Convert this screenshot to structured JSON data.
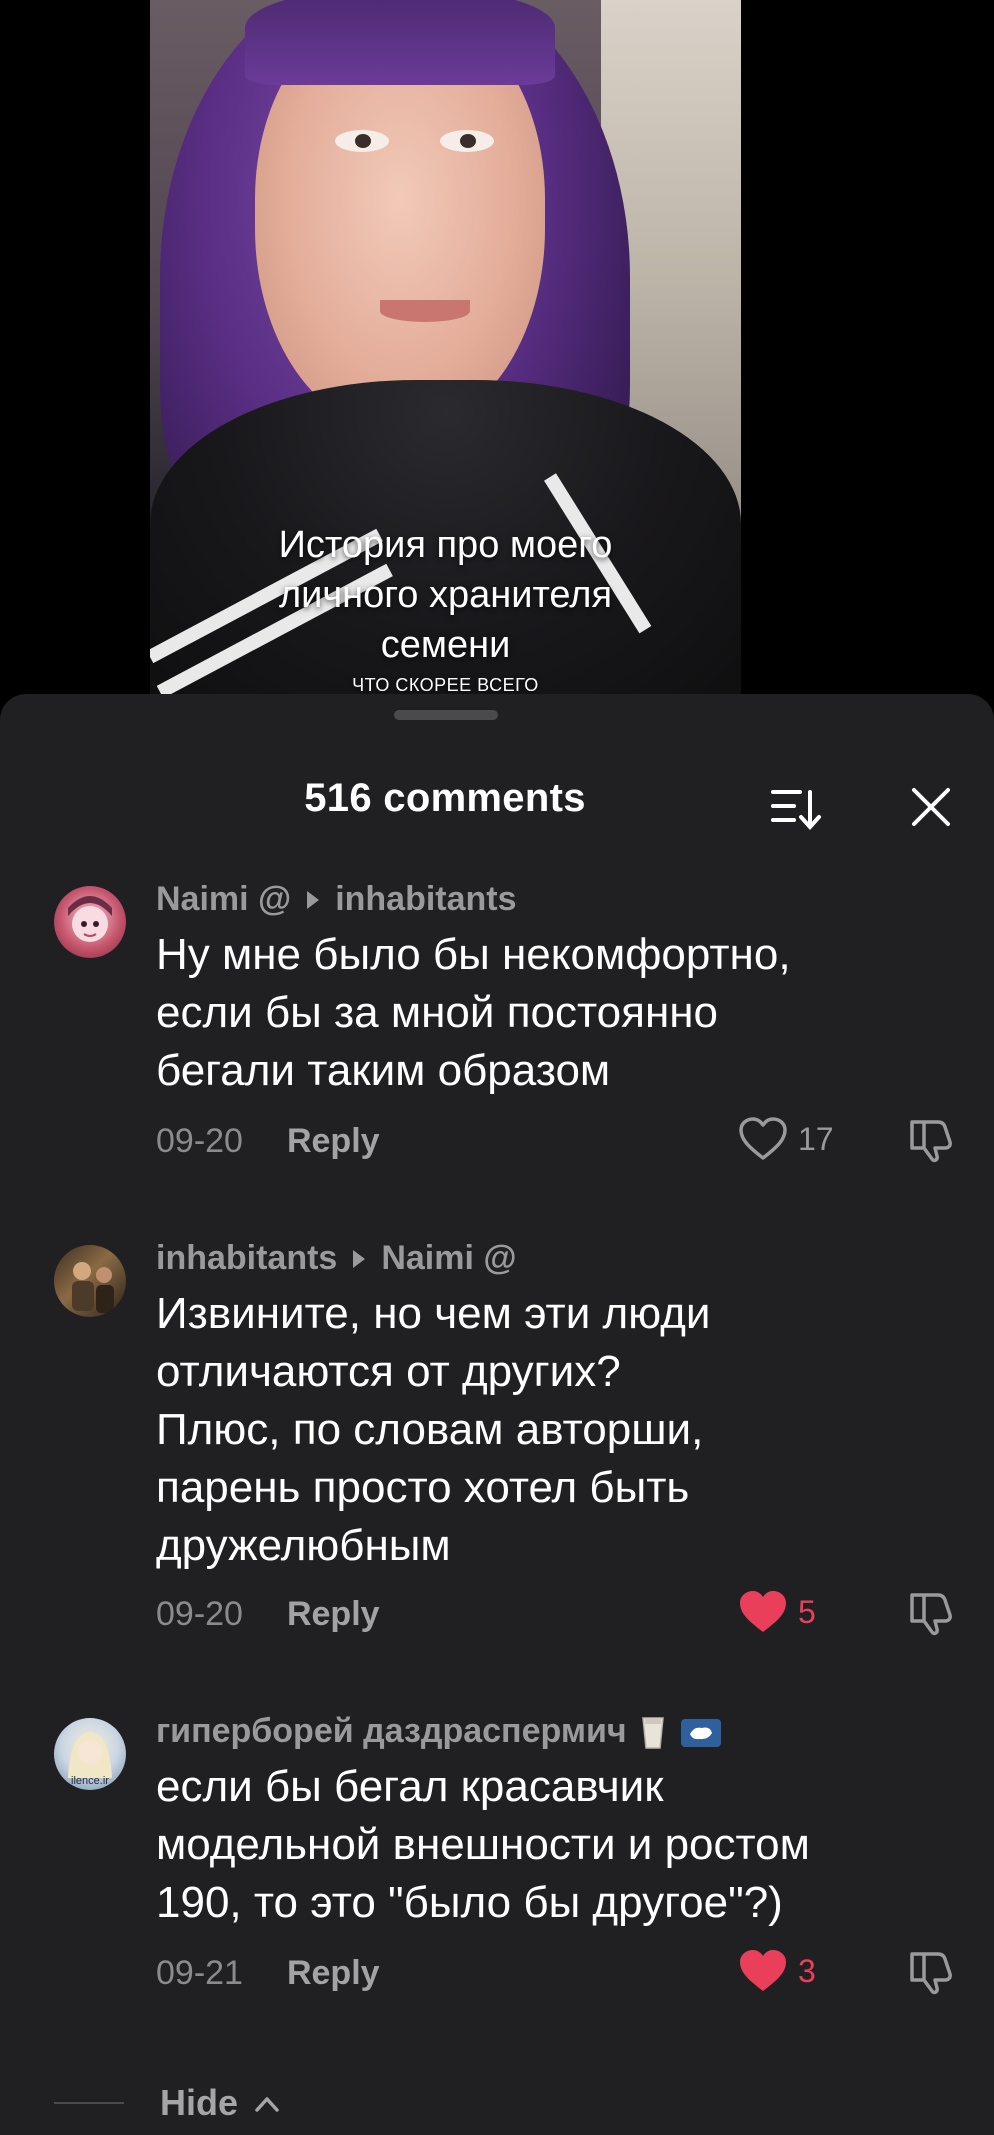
{
  "video": {
    "caption_line1": "История про моего",
    "caption_line2": "личного хранителя",
    "caption_line3": "семени",
    "caption_small": "ЧТО СКОРЕЕ ВСЕГО"
  },
  "sheet": {
    "title": "516 comments",
    "sort_icon": "sort-icon",
    "close_icon": "close-icon"
  },
  "comments": [
    {
      "author": "Naimi @",
      "reply_to": "inhabitants",
      "text_lines": [
        "Ну мне было бы некомфортно,",
        "если бы за мной постоянно",
        "бегали таким образом"
      ],
      "date": "09-20",
      "reply_label": "Reply",
      "likes": "17",
      "liked": false
    },
    {
      "author": "inhabitants",
      "reply_to": "Naimi @",
      "text_lines": [
        "Извините, но чем эти люди",
        "отличаются от других?",
        "Плюс, по словам авторши,",
        "парень просто хотел быть",
        "дружелюбным"
      ],
      "date": "09-20",
      "reply_label": "Reply",
      "likes": "5",
      "liked": true
    },
    {
      "author": "гиперборей даздраспермич",
      "author_emojis": [
        "milk-glass-icon",
        "antarctica-flag-icon"
      ],
      "text_lines": [
        "если бы бегал красавчик",
        "модельной внешности и ростом",
        "190, то это \"было бы другое\"?)"
      ],
      "date": "09-21",
      "reply_label": "Reply",
      "likes": "3",
      "liked": true,
      "avatar_text": "ilence.ir"
    }
  ],
  "hide_label": "Hide",
  "colors": {
    "sheet_bg": "#202022",
    "liked_red": "#ea3f5a",
    "muted_text": "#9a9a9c"
  }
}
